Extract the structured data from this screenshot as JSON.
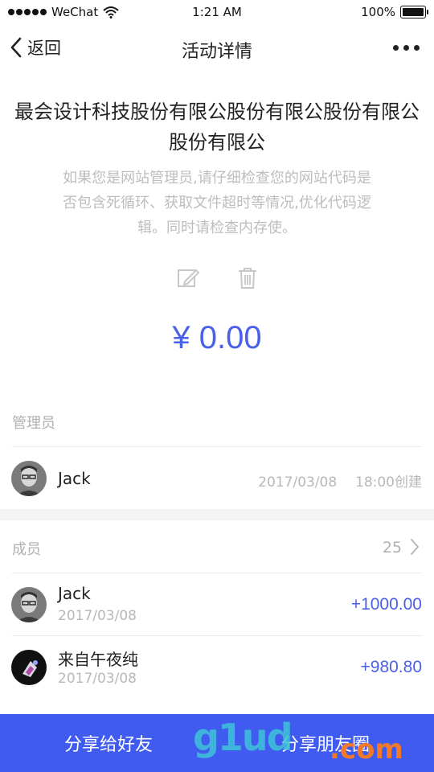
{
  "status_bar": {
    "carrier": "WeChat",
    "time": "1:21 AM",
    "battery": "100%"
  },
  "nav": {
    "back_label": "返回",
    "title": "活动详情"
  },
  "activity": {
    "company": "最会设计科技股份有限公股份有限公股份有限公股份有限公",
    "description": "如果您是网站管理员,请仔细检查您的网站代码是否包含死循环、获取文件超时等情况,优化代码逻辑。同时请检查内存使。",
    "amount": "¥ 0.00"
  },
  "admin_section": {
    "label": "管理员",
    "admin": {
      "name": "Jack",
      "date": "2017/03/08",
      "created": "18:00创建"
    }
  },
  "members_section": {
    "label": "成员",
    "count": "25",
    "members": [
      {
        "name": "Jack",
        "date": "2017/03/08",
        "amount": "+1000.00"
      },
      {
        "name": "来自午夜纯",
        "date": "2017/03/08",
        "amount": "+980.80"
      }
    ]
  },
  "bottom_bar": {
    "share_friends": "分享给好友",
    "share_moments": "分享朋友圈"
  },
  "watermark": {
    "text": "g1ud",
    "suffix": ".com"
  },
  "colors": {
    "accent": "#4a60e8",
    "bottom_bar": "#3f5bf0"
  },
  "icons": [
    "signal-dots-icon",
    "wifi-icon",
    "battery-icon",
    "back-chevron-icon",
    "more-icon",
    "edit-icon",
    "trash-icon",
    "chevron-right-icon"
  ]
}
